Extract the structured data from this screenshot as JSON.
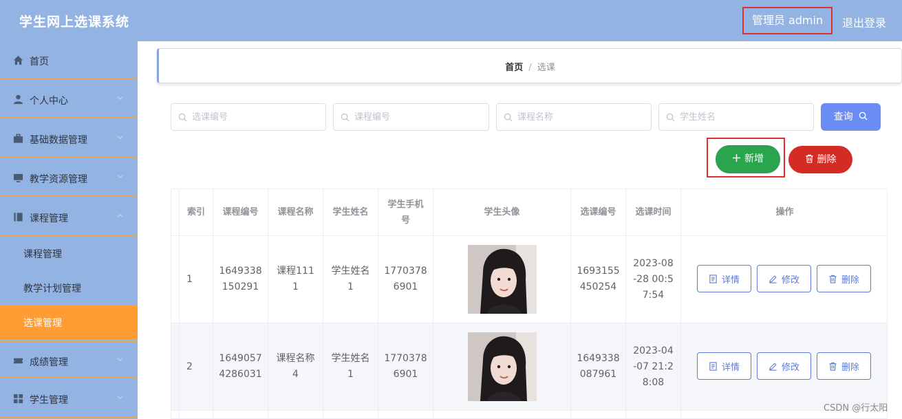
{
  "header": {
    "title": "学生网上选课系统",
    "user_label": "管理员 admin",
    "logout_label": "退出登录"
  },
  "sidebar": {
    "items": [
      {
        "label": "首页",
        "icon": "home-icon"
      },
      {
        "label": "个人中心",
        "icon": "user-icon"
      },
      {
        "label": "基础数据管理",
        "icon": "briefcase-icon"
      },
      {
        "label": "教学资源管理",
        "icon": "monitor-icon"
      },
      {
        "label": "课程管理",
        "icon": "book-icon"
      }
    ],
    "sub_items": [
      {
        "label": "课程管理"
      },
      {
        "label": "教学计划管理"
      },
      {
        "label": "选课管理"
      }
    ],
    "more_items": [
      {
        "label": "成绩管理",
        "icon": "ticket-icon"
      },
      {
        "label": "学生管理",
        "icon": "grid-icon"
      }
    ]
  },
  "breadcrumb": {
    "home": "首页",
    "separator": "/",
    "current": "选课"
  },
  "search": {
    "placeholders": [
      "选课编号",
      "课程编号",
      "课程名称",
      "学生姓名"
    ],
    "query_label": "查询"
  },
  "toolbar": {
    "add_label": "新增",
    "delete_label": "删除"
  },
  "table": {
    "headers": [
      "索引",
      "课程编号",
      "课程名称",
      "学生姓名",
      "学生手机号",
      "学生头像",
      "选课编号",
      "选课时间",
      "操作"
    ],
    "rows": [
      {
        "index": "1",
        "course_no": "1649338150291",
        "course_name": "课程1111",
        "student_name": "学生姓名1",
        "phone": "17703786901",
        "select_no": "1693155450254",
        "select_time": "2023-08-28 00:57:54"
      },
      {
        "index": "2",
        "course_no": "16490574286031",
        "course_name": "课程名称4",
        "student_name": "学生姓名1",
        "phone": "17703786901",
        "select_no": "1649338087961",
        "select_time": "2023-04-07 21:28:08"
      }
    ],
    "actions": {
      "detail": "详情",
      "edit": "修改",
      "delete": "删除"
    }
  },
  "watermark": "CSDN @行太阳",
  "colors": {
    "header_bg": "#93b3e2",
    "active_menu": "#ff9c33",
    "query_button": "#6c8cf5",
    "add_button": "#2aa44f",
    "delete_button": "#d42b24",
    "action_outline": "#5d7bd6"
  }
}
